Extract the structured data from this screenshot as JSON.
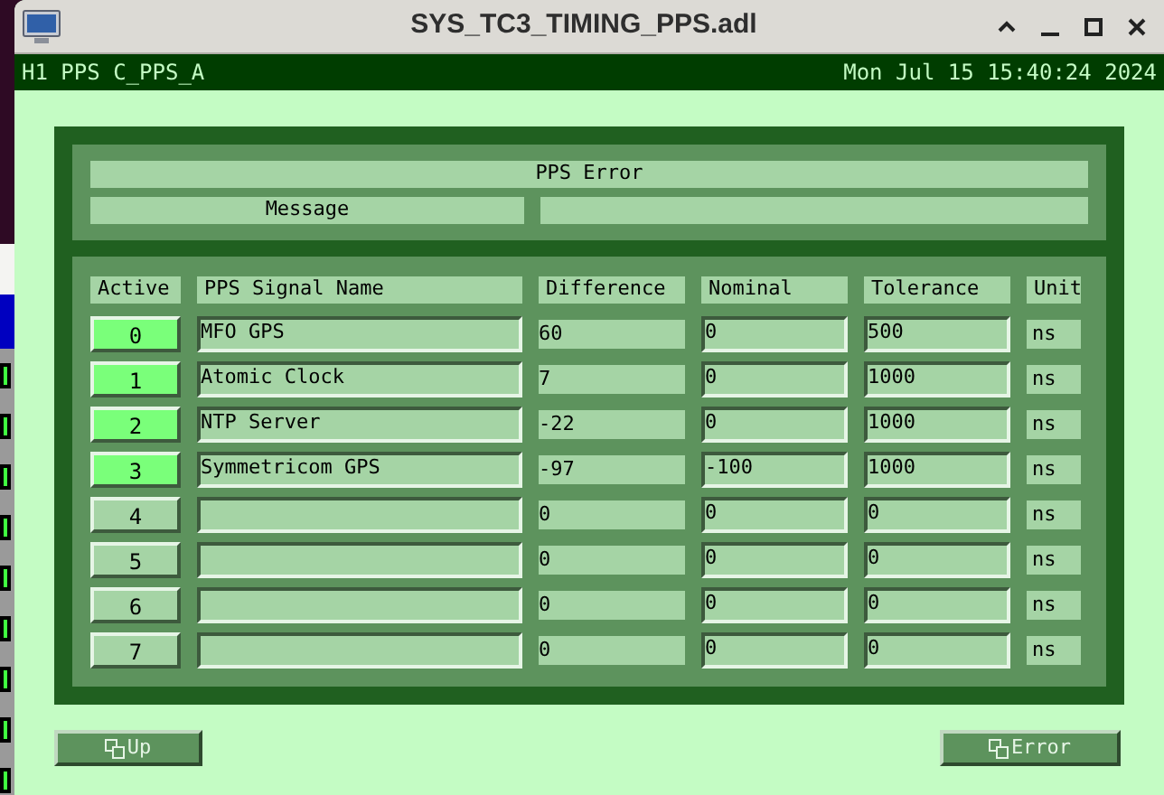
{
  "window": {
    "title": "SYS_TC3_TIMING_PPS.adl"
  },
  "header": {
    "left": "H1 PPS C_PPS_A",
    "right": "Mon Jul 15 15:40:24 2024"
  },
  "error_panel": {
    "title": "PPS Error",
    "message_label": "Message"
  },
  "table": {
    "columns": [
      "Active",
      "PPS Signal Name",
      "Difference",
      "Nominal",
      "Tolerance",
      "Unit"
    ],
    "rows": [
      {
        "index": "0",
        "active": true,
        "name": "MFO GPS",
        "difference": "60",
        "nominal": "0",
        "tolerance": "500",
        "unit": "ns"
      },
      {
        "index": "1",
        "active": true,
        "name": "Atomic Clock",
        "difference": "7",
        "nominal": "0",
        "tolerance": "1000",
        "unit": "ns"
      },
      {
        "index": "2",
        "active": true,
        "name": "NTP Server",
        "difference": "-22",
        "nominal": "0",
        "tolerance": "1000",
        "unit": "ns"
      },
      {
        "index": "3",
        "active": true,
        "name": "Symmetricom GPS",
        "difference": "-97",
        "nominal": "-100",
        "tolerance": "1000",
        "unit": "ns"
      },
      {
        "index": "4",
        "active": false,
        "difference": "0",
        "nominal": "0",
        "tolerance": "0",
        "unit": "ns"
      },
      {
        "index": "5",
        "active": false,
        "difference": "0",
        "nominal": "0",
        "tolerance": "0",
        "unit": "ns"
      },
      {
        "index": "6",
        "active": false,
        "difference": "0",
        "nominal": "0",
        "tolerance": "0",
        "unit": "ns"
      },
      {
        "index": "7",
        "active": false,
        "difference": "0",
        "nominal": "0",
        "tolerance": "0",
        "unit": "ns"
      }
    ]
  },
  "buttons": [
    {
      "label": "Up"
    },
    {
      "label": "Error"
    }
  ]
}
